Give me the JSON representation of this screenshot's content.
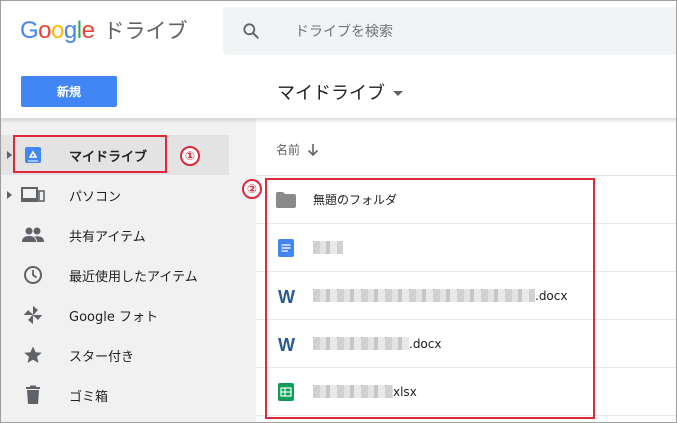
{
  "header": {
    "logo_letters": [
      "G",
      "o",
      "o",
      "g",
      "l",
      "e"
    ],
    "logo_colors": [
      "#4285f4",
      "#ea4335",
      "#fbbc05",
      "#4285f4",
      "#34a853",
      "#ea4335"
    ],
    "product_name": "ドライブ",
    "search_placeholder": "ドライブを検索"
  },
  "toolbar": {
    "new_label": "新規",
    "location_title": "マイドライブ"
  },
  "sidebar": {
    "items": [
      {
        "label": "マイドライブ",
        "icon": "my-drive-icon",
        "active": true,
        "expandable": true
      },
      {
        "label": "パソコン",
        "icon": "computers-icon",
        "active": false,
        "expandable": true
      },
      {
        "label": "共有アイテム",
        "icon": "shared-people-icon",
        "active": false,
        "expandable": false
      },
      {
        "label": "最近使用したアイテム",
        "icon": "clock-icon",
        "active": false,
        "expandable": false
      },
      {
        "label": "Google フォト",
        "icon": "photos-pinwheel-icon",
        "active": false,
        "expandable": false
      },
      {
        "label": "スター付き",
        "icon": "star-icon",
        "active": false,
        "expandable": false
      },
      {
        "label": "ゴミ箱",
        "icon": "trash-icon",
        "active": false,
        "expandable": false
      }
    ]
  },
  "file_list": {
    "column_name": "名前",
    "rows": [
      {
        "name": "無題のフォルダ",
        "icon": "folder-icon",
        "suffix": ""
      },
      {
        "name": "",
        "icon": "google-docs-icon",
        "suffix": ""
      },
      {
        "name": "",
        "icon": "word-icon",
        "suffix": ".docx"
      },
      {
        "name": "",
        "icon": "word-icon",
        "suffix": ".docx"
      },
      {
        "name": "",
        "icon": "sheets-icon",
        "suffix": "xlsx"
      }
    ]
  },
  "annotations": {
    "mark_1": "①",
    "mark_2": "②",
    "color": "#e0283a"
  },
  "colors": {
    "accent": "#4285f4",
    "sidebar_bg": "#f1f1f1",
    "active_bg": "#e3e3e3"
  }
}
